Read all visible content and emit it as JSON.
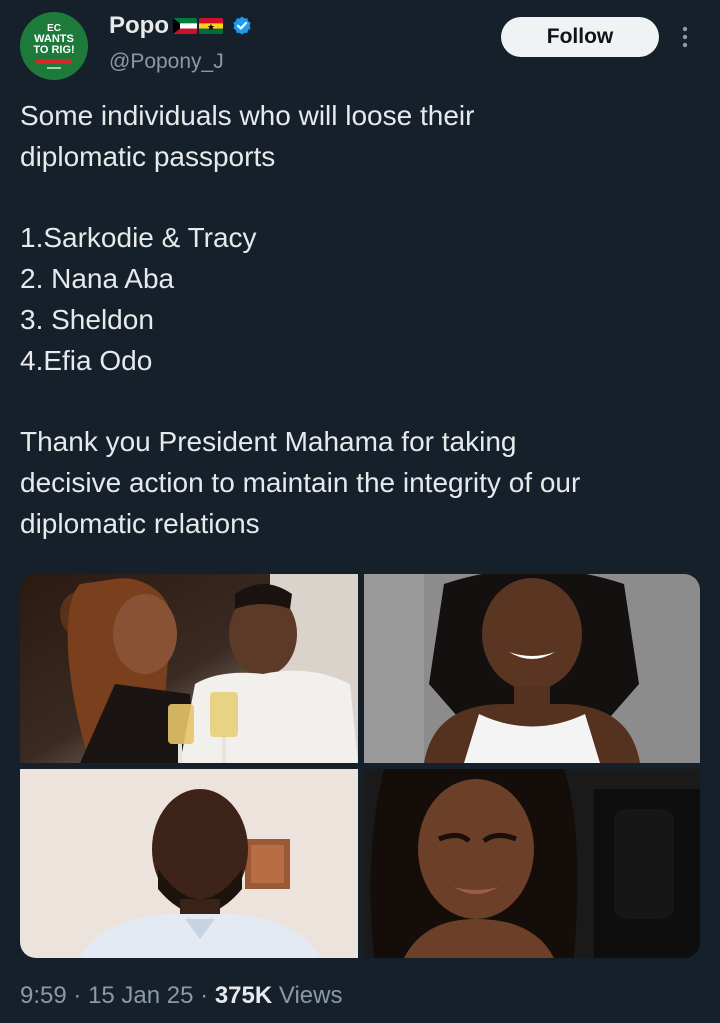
{
  "author": {
    "display_name": "Popo",
    "handle": "@Popony_J",
    "avatar": {
      "line1": "EC",
      "line2": "WANTS",
      "line3": "TO RIG!",
      "background": "#1d7a3a"
    },
    "badges": [
      "kuwait-flag-icon",
      "ghana-flag-icon",
      "verified-badge-icon"
    ],
    "verified_color": "#1d9bf0"
  },
  "follow_label": "Follow",
  "tweet": {
    "text": "Some individuals who will loose their\ndiplomatic passports\n\n1.Sarkodie & Tracy\n2. Nana Aba\n3. Sheldon\n4.Efia Odo\n\nThank you President Mahama for taking\ndecisive action to maintain the integrity of our\ndiplomatic relations"
  },
  "media": {
    "count": 4,
    "photos": [
      "photo-couple",
      "photo-woman-white-top",
      "photo-man",
      "photo-woman-car"
    ]
  },
  "meta": {
    "time": "9:59",
    "sep1": "·",
    "date": "15 Jan 25",
    "sep2": "·",
    "views_count": "375K",
    "views_label": "Views"
  },
  "colors": {
    "background": "#15202b",
    "text": "#e7e9ea",
    "secondary_text": "#8b98a5",
    "follow_bg": "#eff3f4"
  }
}
